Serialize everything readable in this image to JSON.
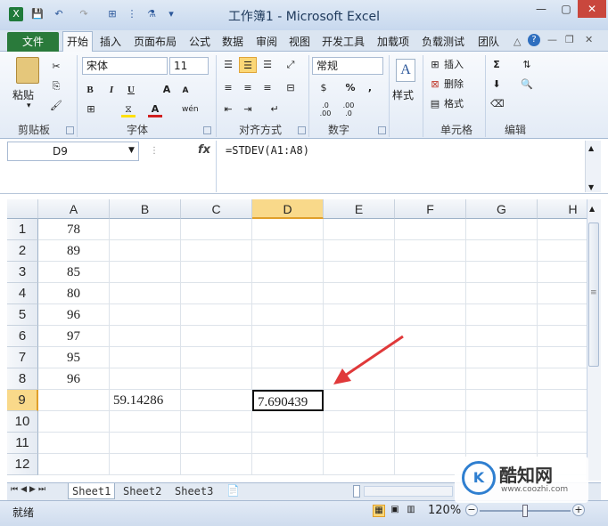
{
  "window": {
    "title": "工作簿1 - Microsoft Excel"
  },
  "ribbon": {
    "file_tab": "文件",
    "tabs": [
      "开始",
      "插入",
      "页面布局",
      "公式",
      "数据",
      "审阅",
      "视图",
      "开发工具",
      "加载项",
      "负载测试",
      "团队"
    ],
    "clipboard": {
      "paste": "粘贴",
      "group": "剪贴板"
    },
    "font": {
      "name": "宋体",
      "size": "11",
      "group": "字体",
      "bold": "B",
      "italic": "I",
      "underline": "U",
      "grow": "A",
      "shrink": "A",
      "color": "A",
      "phonetic": "wén"
    },
    "alignment": {
      "group": "对齐方式"
    },
    "number": {
      "format": "常规",
      "group": "数字",
      "percent": "%",
      "comma": ",",
      "inc_dec": ".0 .00",
      "dec_dec": ".00 .0"
    },
    "styles": {
      "label": "样式"
    },
    "cells": {
      "insert": "插入",
      "delete": "删除",
      "format": "格式",
      "group": "单元格"
    },
    "editing": {
      "sum": "Σ",
      "group": "编辑"
    }
  },
  "formula_bar": {
    "name_box": "D9",
    "fx": "fx",
    "formula": "=STDEV(A1:A8)"
  },
  "grid": {
    "columns": [
      "A",
      "B",
      "C",
      "D",
      "E",
      "F",
      "G",
      "H"
    ],
    "rows": [
      {
        "n": "1",
        "A": "78",
        "B": "",
        "D": ""
      },
      {
        "n": "2",
        "A": "89",
        "B": "",
        "D": ""
      },
      {
        "n": "3",
        "A": "85",
        "B": "",
        "D": ""
      },
      {
        "n": "4",
        "A": "80",
        "B": "",
        "D": ""
      },
      {
        "n": "5",
        "A": "96",
        "B": "",
        "D": ""
      },
      {
        "n": "6",
        "A": "97",
        "B": "",
        "D": ""
      },
      {
        "n": "7",
        "A": "95",
        "B": "",
        "D": ""
      },
      {
        "n": "8",
        "A": "96",
        "B": "",
        "D": ""
      },
      {
        "n": "9",
        "A": "",
        "B": "59.14286",
        "D": "7.690439"
      },
      {
        "n": "10",
        "A": "",
        "B": "",
        "D": ""
      },
      {
        "n": "11",
        "A": "",
        "B": "",
        "D": ""
      },
      {
        "n": "12",
        "A": "",
        "B": "",
        "D": ""
      }
    ]
  },
  "sheets": [
    "Sheet1",
    "Sheet2",
    "Sheet3"
  ],
  "status": {
    "ready": "就绪",
    "zoom": "120%"
  },
  "watermark": {
    "brand": "酷知网",
    "url": "www.coozhi.com"
  },
  "colors": {
    "accent": "#2a7a3b",
    "arrow": "#e0393a",
    "selected_header": "#f9d98a"
  }
}
